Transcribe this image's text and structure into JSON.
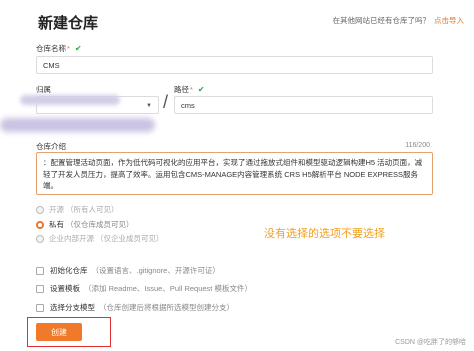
{
  "header": {
    "title": "新建仓库",
    "import_hint": "在其他网站已经有仓库了吗？",
    "import_link": "点击导入"
  },
  "repo_name": {
    "label": "仓库名称",
    "required_mark": "*",
    "value": "CMS"
  },
  "owner": {
    "label": "归属"
  },
  "path": {
    "label": "路径",
    "required_mark": "*",
    "value": "cms"
  },
  "intro": {
    "label": "仓库介绍",
    "counter": "116/200",
    "value": "：配置管理活动页面，作为低代码可视化的应用平台，实现了通过拖放式组件和模型驱动逻辑构建H5 活动页面，减轻了开发人员压力，提高了效率。运用包含CMS-MANAGE内容管理系统 CRS H5解析平台 NODE EXPRESS服务端。"
  },
  "visibility": {
    "options": [
      {
        "label": "开源",
        "hint": "（所有人可见）",
        "checked": false,
        "disabled": true
      },
      {
        "label": "私有",
        "hint": "（仅仓库成员可见）",
        "checked": true,
        "disabled": false
      },
      {
        "label": "企业内部开源",
        "hint": "（仅企业成员可见）",
        "checked": false,
        "disabled": true
      }
    ]
  },
  "annotation": "没有选择的选项不要选择",
  "init_options": [
    {
      "label": "初始化仓库",
      "hint": "（设置语言、.gitignore、开源许可证）"
    },
    {
      "label": "设置模板",
      "hint": "（添加 Readme、Issue、Pull Request 模板文件）"
    },
    {
      "label": "选择分支模型",
      "hint": "（仓库创建后将根据所选模型创建分支）"
    }
  ],
  "create_button": "创建",
  "watermark": "CSDN @吃胖了的够哈",
  "colors": {
    "accent": "#f07a2a",
    "check": "#2ea44f",
    "annotation": "#f0a020",
    "highlight_box": "#e03030"
  }
}
